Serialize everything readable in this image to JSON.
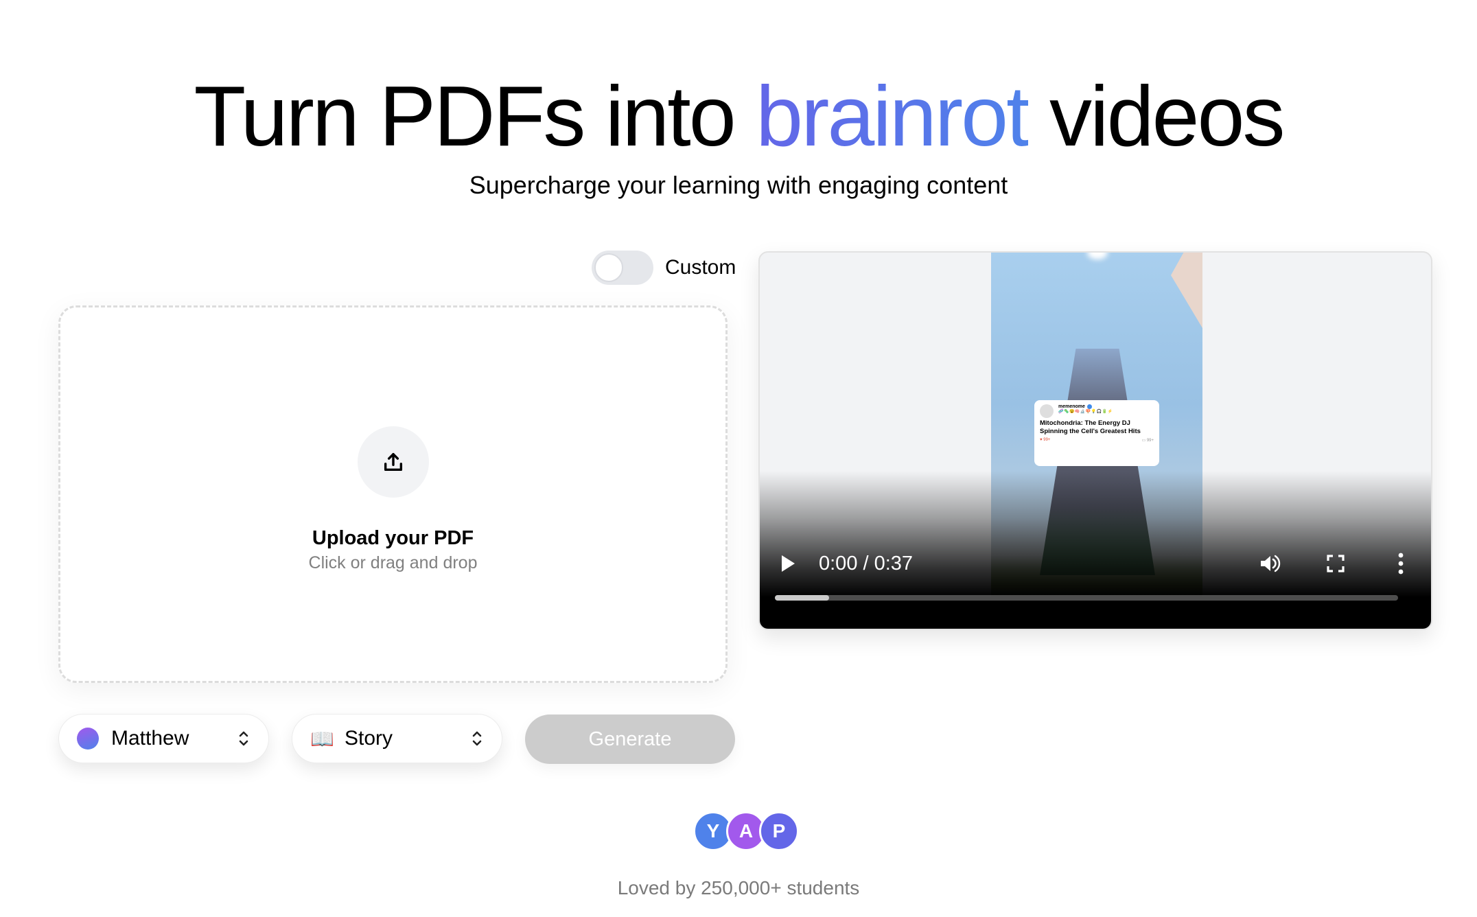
{
  "hero": {
    "title_before": "Turn PDFs into ",
    "title_accent": "brainrot",
    "title_after": " videos",
    "subtitle": "Supercharge your learning with engaging content",
    "accent_gradient": [
      "#6366e8",
      "#4f82ea"
    ]
  },
  "custom_toggle": {
    "label": "Custom",
    "on": false
  },
  "upload": {
    "icon": "upload-icon",
    "title": "Upload your PDF",
    "subtitle": "Click or drag and drop"
  },
  "controls": {
    "voice_select": {
      "value": "Matthew",
      "icon": "voice-color-dot"
    },
    "style_select": {
      "value": "Story",
      "icon": "📖"
    },
    "generate_label": "Generate",
    "generate_enabled": false
  },
  "video": {
    "current_time": "0:00",
    "duration": "0:37",
    "time_display": "0:00 / 0:37",
    "buffered_fraction": 0.087,
    "played_fraction": 0,
    "icons": [
      "play-icon",
      "volume-icon",
      "fullscreen-icon",
      "more-options-icon"
    ],
    "overlay_post": {
      "username": "memenome",
      "verified": true,
      "emojis": "🧬🦠😵🧠🔬🍄💡🎧🔋⚡",
      "title": "Mitochondria: The Energy DJ Spinning the Cell's Greatest Hits",
      "likes": "99+",
      "comments": "99+"
    }
  },
  "social_proof": {
    "avatars": [
      {
        "letter": "Y",
        "color": "#4f82ea"
      },
      {
        "letter": "A",
        "color": "#a259ec"
      },
      {
        "letter": "P",
        "color": "#6366e8"
      }
    ],
    "text": "Loved by 250,000+ students"
  }
}
